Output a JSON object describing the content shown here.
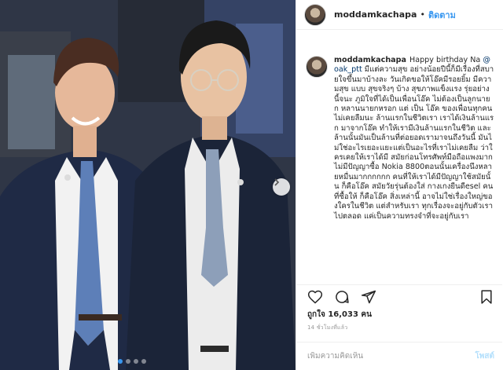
{
  "post": {
    "username": "moddamkachapa",
    "follow_label": "ติดตาม",
    "separator": "•",
    "caption_username": "moddamkachapa",
    "caption_lead": "Happy birthday Na ",
    "mention": "@oak_ptt",
    "caption_body": " มีแต่ความสุข อย่างน้อยปีนี้ก็มีเรื่องที่สบายใจขึ้นมาบ้างละ วันเกิดขอให้โอ๊คมีรอยยิ้ม มีความสุข แบบ สุขจริงๆ บ้าง สุขภาพแข็งแรง รุ่ยอย่างนี้จนะ ภูมิใจที่ได้เป็นเพื่อนโอ๊ค ไม่ต้องเป็นลูกนายก หลานนายกหรอก แต่ เป็น โอ๊ค ของเพื่อนทุกคน ไม่เคยลืมนะ ล้านแรกในชีวิตเรา เราได้เงินล้านแรก มาจากโอ๊ค ทำให้เรามีเงินล้านแรกในชีวิต และล้านนั้นมันเป็นล้านที่ต่อยอดเรามาจนถึงวันนี้ มันไม่ใช่อะไรเยอะแยะแต่เป็นอะไรที่เราไม่เคยลืม ว่าใครเคยให้เราได้มี สมัยก่อนโทรศัพท์มือถือแพงมาก ไม่มีปัญญาซื้อ Nokia 8800ตอนนั้นเครื่องนึงหลายหมื่นมากกกกกก คนที่ให้เราได้มีปัญญาใช้สมัยนั้น ก็คือโอ๊ค สมัยวัยรุ่นต้องใส่ กางเกงยีนดีesel คนที่ซื้อให้ ก็คือโอ๊ค สิ่งเหล่านี้ อาจไม่ใช่เรื่องใหญ่ของใครในชีวิต แต่สำหรับเรา ทุกเรื่องจะอยู่กับตัวเราไปตลอด แค่เป็นความทรงจำที่จะอยู่กับเรา",
    "likes_text": "ถูกใจ 16,033 คน",
    "time_ago": "14 ชั่วโมงที่แล้ว",
    "comment_placeholder": "เพิ่มความคิดเห็น",
    "post_label": "โพสต์"
  },
  "icons": {
    "like": "heart-icon",
    "comment": "comment-icon",
    "share": "share-icon",
    "save": "bookmark-icon",
    "next": "chevron-right-icon"
  },
  "carousel": {
    "total": 4,
    "active_index": 0
  },
  "colors": {
    "accent": "#3897f0",
    "text": "#262626",
    "muted": "#999999",
    "border": "#efefef"
  }
}
